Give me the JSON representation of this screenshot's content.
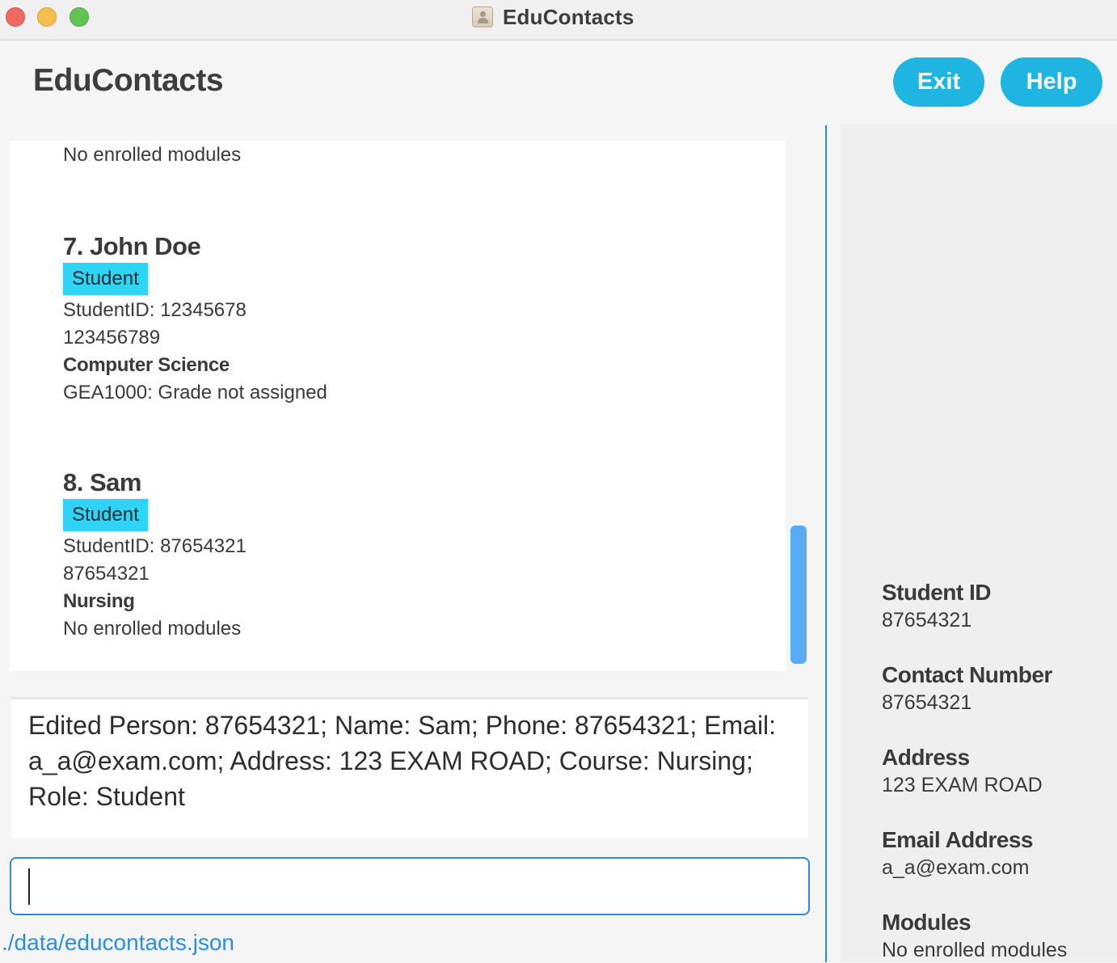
{
  "window": {
    "title": "EduContacts"
  },
  "header": {
    "app_title": "EduContacts",
    "exit_label": "Exit",
    "help_label": "Help"
  },
  "person_list": {
    "partial_top_line": "No enrolled modules",
    "cards": [
      {
        "name": "7. John Doe",
        "role": "Student",
        "student_id": "StudentID: 12345678",
        "phone": "123456789",
        "course": "Computer Science",
        "modules": "GEA1000: Grade not assigned"
      },
      {
        "name": "8. Sam",
        "role": "Student",
        "student_id": "StudentID: 87654321",
        "phone": "87654321",
        "course": "Nursing",
        "modules": "No enrolled modules"
      }
    ]
  },
  "result_display": {
    "text": "Edited Person: 87654321; Name: Sam; Phone: 87654321; Email: a_a@exam.com; Address: 123 EXAM ROAD; Course: Nursing; Role: Student"
  },
  "command_box": {
    "value": ""
  },
  "status_bar": {
    "file_path": "./data/educontacts.json"
  },
  "details": {
    "student_id_label": "Student ID",
    "student_id": "87654321",
    "contact_label": "Contact Number",
    "contact": "87654321",
    "address_label": "Address",
    "address": "123 EXAM ROAD",
    "email_label": "Email Address",
    "email": "a_a@exam.com",
    "modules_label": "Modules",
    "modules": "No enrolled modules"
  },
  "colors": {
    "accent": "#1fb5e2",
    "role_tag": "#2ed3f5",
    "focus_border": "#2b8be0",
    "link": "#2d8de4",
    "scrollbar": "#5aabf5"
  },
  "icons": {
    "window_close": "close-traffic-light-icon",
    "window_minimize": "minimize-traffic-light-icon",
    "window_maximize": "maximize-traffic-light-icon",
    "app": "contacts-app-icon"
  }
}
